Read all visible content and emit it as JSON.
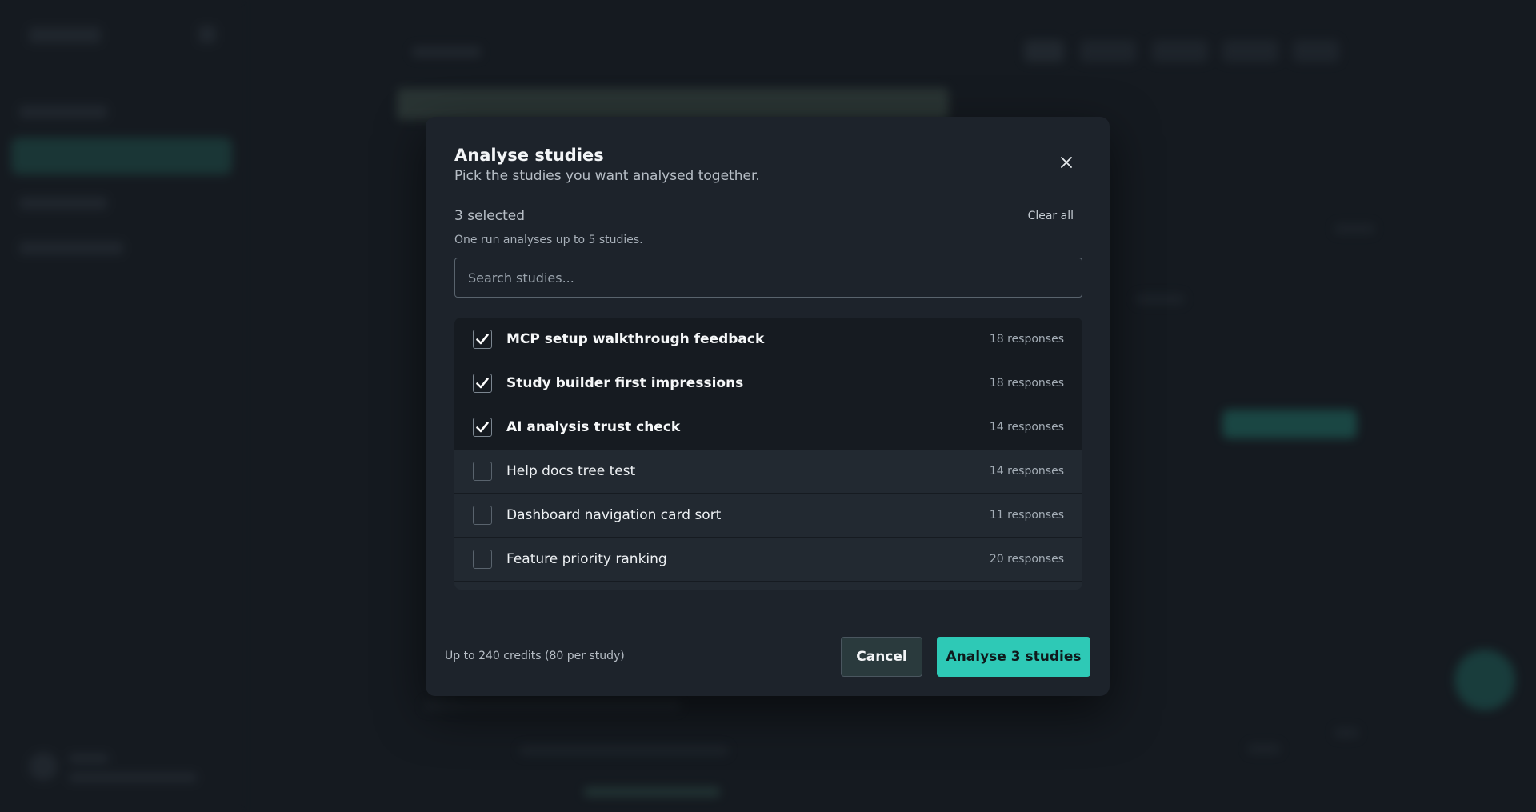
{
  "modal": {
    "title": "Analyse studies",
    "subtitle": "Pick the studies you want analysed together.",
    "selected_count": "3 selected",
    "clear_all_label": "Clear all",
    "limit_note": "One run analyses up to 5 studies.",
    "search": {
      "placeholder": "Search studies...",
      "value": ""
    },
    "studies": [
      {
        "name": "MCP setup walkthrough feedback",
        "responses": "18 responses",
        "checked": true
      },
      {
        "name": "Study builder first impressions",
        "responses": "18 responses",
        "checked": true
      },
      {
        "name": "AI analysis trust check",
        "responses": "14 responses",
        "checked": true
      },
      {
        "name": "Help docs tree test",
        "responses": "14 responses",
        "checked": false
      },
      {
        "name": "Dashboard navigation card sort",
        "responses": "11 responses",
        "checked": false
      },
      {
        "name": "Feature priority ranking",
        "responses": "20 responses",
        "checked": false
      }
    ],
    "footer": {
      "credits_note": "Up to 240 credits (80 per study)",
      "cancel_label": "Cancel",
      "primary_label": "Analyse 3 studies"
    }
  },
  "colors": {
    "accent": "#2ec9b6",
    "modal_bg": "#1d232b",
    "page_bg": "#151a20"
  },
  "icons": {
    "close": "close-icon",
    "checkbox_checked": "checkmark-icon"
  }
}
